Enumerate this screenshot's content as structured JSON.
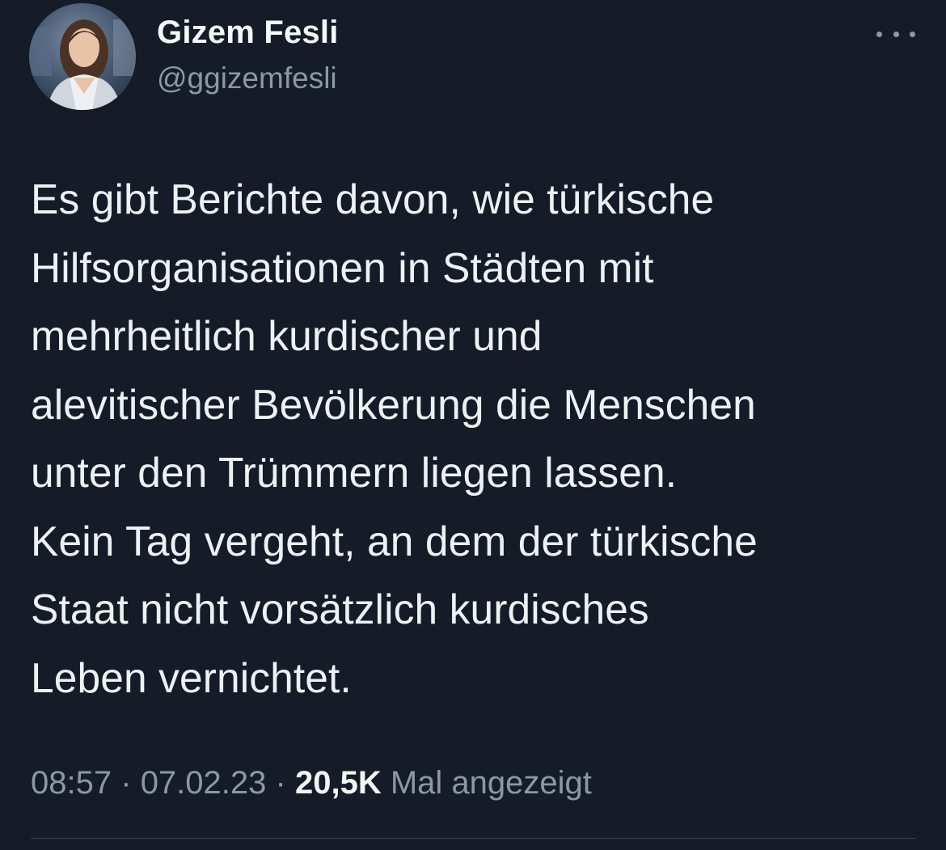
{
  "author": {
    "display_name": "Gizem Fesli",
    "handle": "@ggizemfesli"
  },
  "tweet": {
    "lines": [
      "Es gibt Berichte davon, wie türkische",
      "Hilfsorganisationen in Städten mit",
      "mehrheitlich kurdischer und",
      "alevitischer Bevölkerung die Menschen",
      "unter den Trümmern liegen lassen.",
      "Kein Tag vergeht, an dem der türkische",
      "Staat nicht vorsätzlich kurdisches",
      "Leben vernichtet."
    ]
  },
  "meta": {
    "time": "08:57",
    "separator": "·",
    "date": "07.02.23",
    "views_count": "20,5K",
    "views_label": "Mal angezeigt"
  },
  "icons": {
    "more": "more-options-icon"
  },
  "colors": {
    "background": "#151c28",
    "primary_text": "#eef1f3",
    "secondary_text": "#8b98a5",
    "divider": "#38444d"
  }
}
